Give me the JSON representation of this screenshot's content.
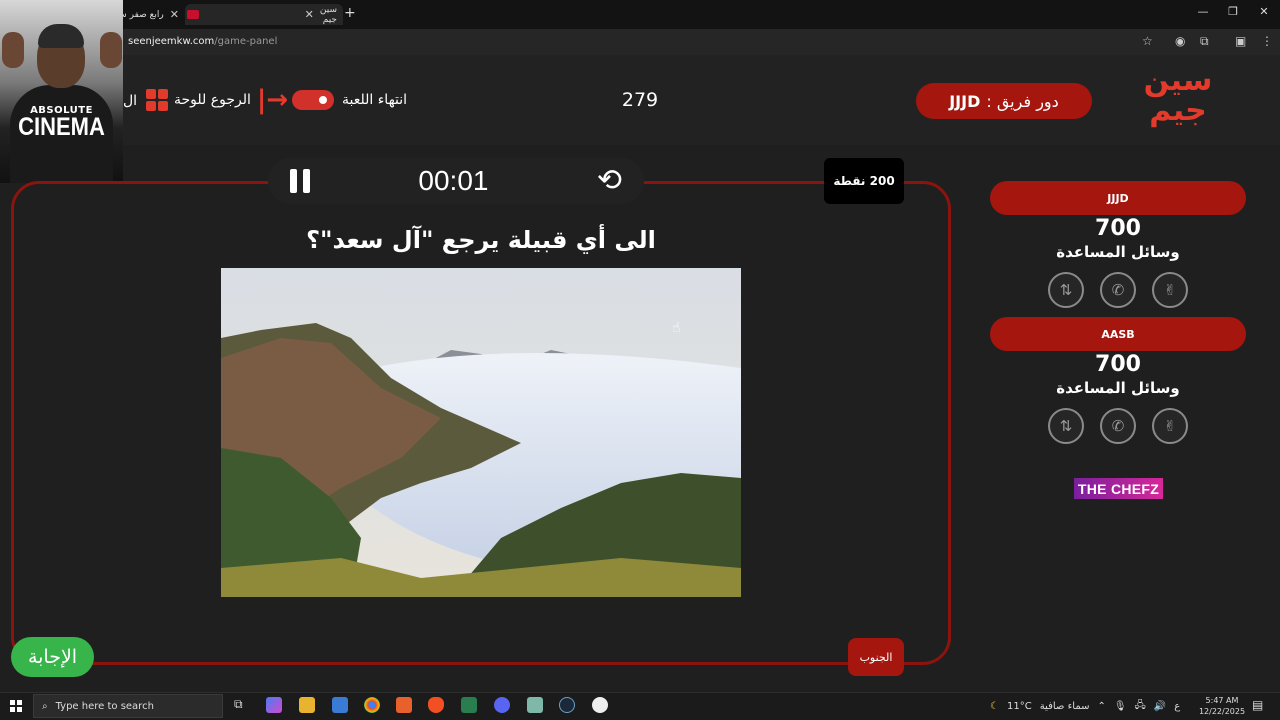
{
  "browser": {
    "tabs": [
      {
        "label": "رابع صفر س"
      },
      {
        "label": "سين جيم"
      }
    ],
    "url_host": "seenjeemkw.com",
    "url_path": "/game-panel"
  },
  "webcam_overlay": {
    "line1": "ABSOLUTE",
    "line2": "CINEMA"
  },
  "header": {
    "logo_text": "سين جيم",
    "turn_label": "دور فريق :",
    "turn_team": "JJJD",
    "score": "279",
    "end_game_label": "انتهاء اللعبة",
    "back_to_board_label": "الرجوع للوحة",
    "cut_label": "ال"
  },
  "question_panel": {
    "timer": "00:01",
    "points": "200 نقطة",
    "question": "الى أي قبيلة يرجع \"آل سعد\"؟",
    "category": "الجنوب",
    "answer_button": "الإجابة"
  },
  "teams": [
    {
      "name": "JJJD",
      "score": "700",
      "aids_label": "وسائل المساعدة"
    },
    {
      "name": "AASB",
      "score": "700",
      "aids_label": "وسائل المساعدة"
    }
  ],
  "sponsor": "THE CHEFZ",
  "taskbar": {
    "search_placeholder": "Type here to search",
    "weather": "11°C",
    "weather_text": "سماء صافية",
    "time": "5:47 AM",
    "date": "12/22/2025",
    "lang": "ع"
  },
  "colors": {
    "accent_red": "#a5160f",
    "logo_red": "#e23a2b",
    "answer_green": "#37b44a"
  }
}
